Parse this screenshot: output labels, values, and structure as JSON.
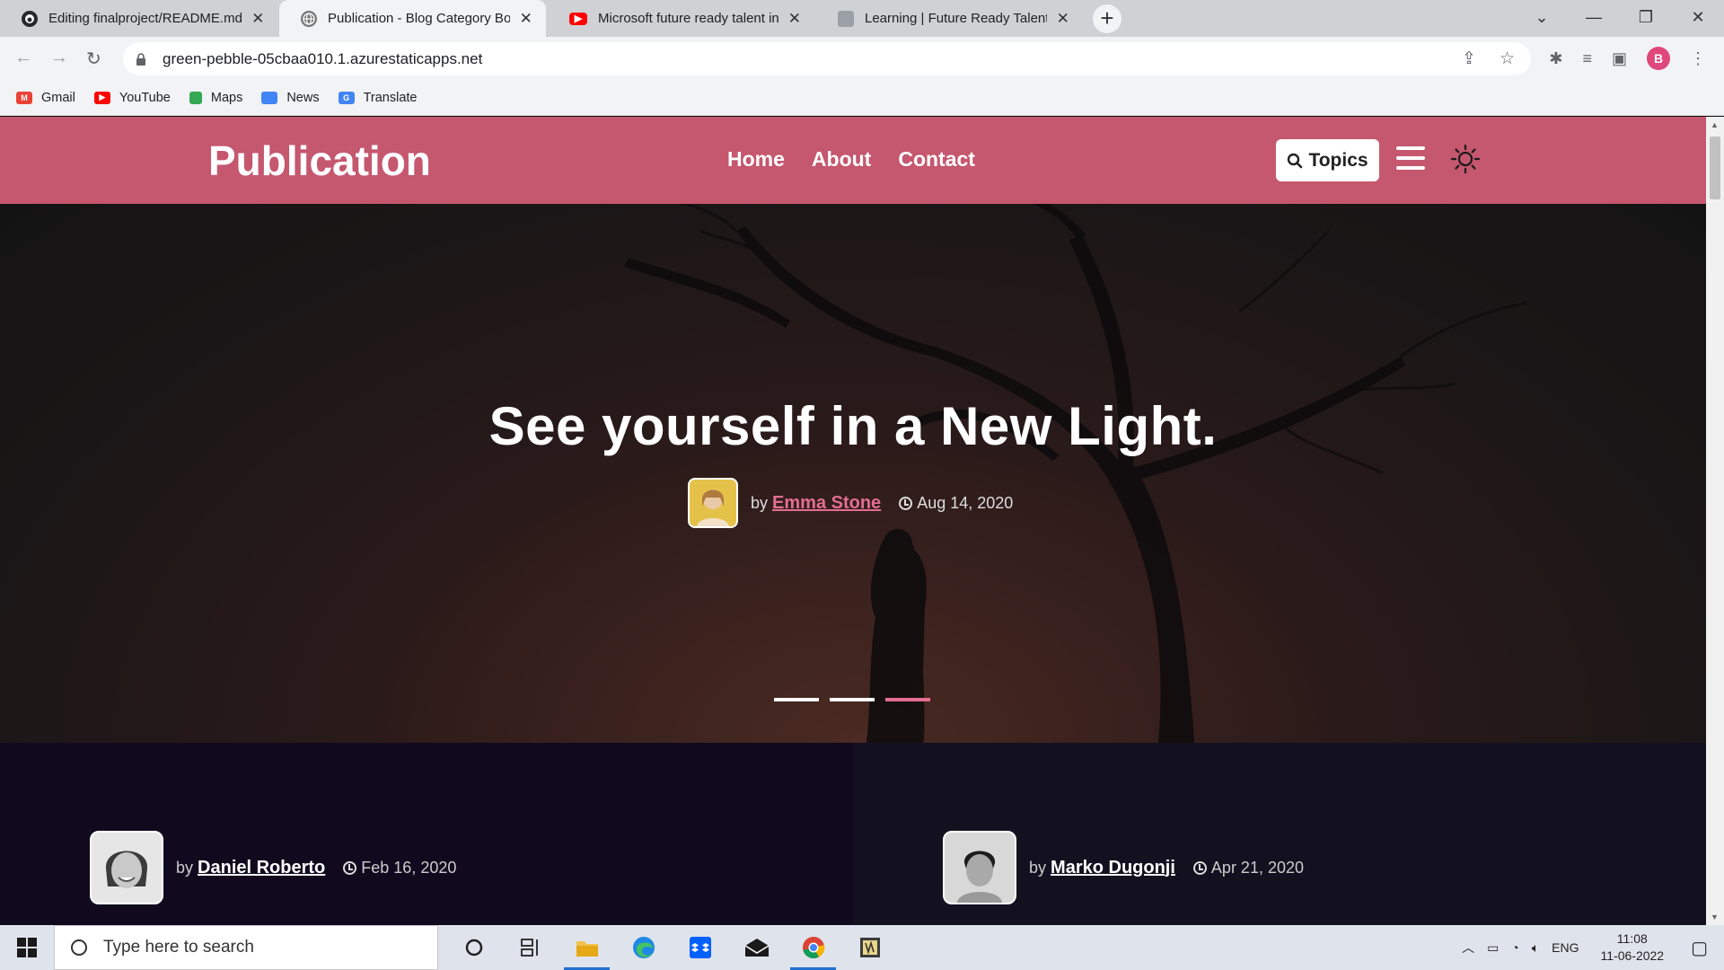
{
  "browser": {
    "tabs": [
      {
        "title": "Editing finalproject/README.md",
        "icon": "github-icon"
      },
      {
        "title": "Publication - Blog Category Boot",
        "icon": "globe-icon"
      },
      {
        "title": "Microsoft future ready talent inte",
        "icon": "youtube-icon"
      },
      {
        "title": "Learning | Future Ready Talent",
        "icon": "page-icon"
      }
    ],
    "active_tab": 1,
    "url": "green-pebble-05cbaa010.1.azurestaticapps.net",
    "profile_initial": "B",
    "bookmarks": [
      {
        "label": "Gmail",
        "color": "#ea4335"
      },
      {
        "label": "YouTube",
        "color": "#ff0000"
      },
      {
        "label": "Maps",
        "color": "#34a853"
      },
      {
        "label": "News",
        "color": "#4285f4"
      },
      {
        "label": "Translate",
        "color": "#4285f4"
      }
    ]
  },
  "site": {
    "brand": "Publication",
    "nav": [
      "Home",
      "About",
      "Contact"
    ],
    "topics_label": "Topics",
    "accent_color": "#c5576f"
  },
  "hero": {
    "title": "See yourself in a New Light.",
    "by": "by",
    "author": "Emma Stone",
    "date": "Aug 14, 2020",
    "slides": 3,
    "active_slide": 2
  },
  "cards": [
    {
      "by": "by",
      "author": "Daniel Roberto",
      "date": "Feb 16, 2020"
    },
    {
      "by": "by",
      "author": "Marko Dugonji",
      "date": "Apr 21, 2020"
    }
  ],
  "taskbar": {
    "search_placeholder": "Type here to search",
    "language": "ENG",
    "time": "11:08",
    "date": "11-06-2022"
  }
}
